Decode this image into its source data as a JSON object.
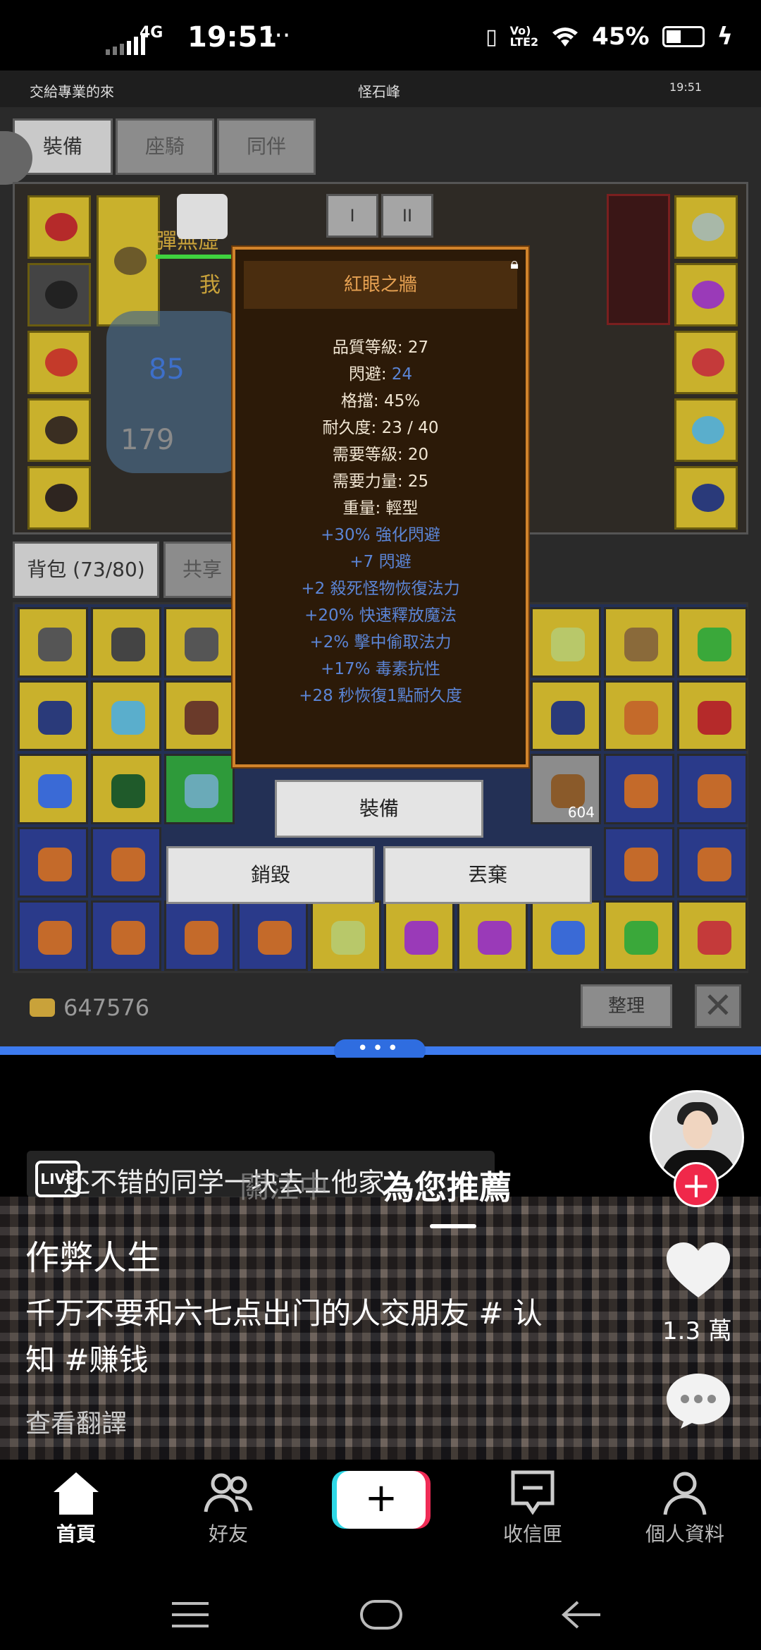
{
  "status_bar": {
    "network": "4G",
    "time": "19:51",
    "more": "···",
    "battery": "45%"
  },
  "game": {
    "header": {
      "left": "交給專業的來",
      "center": "怪石峰",
      "right_time": "19:51"
    },
    "tabs": [
      "裝備",
      "座騎",
      "同伴"
    ],
    "stage_buttons": [
      "I",
      "II"
    ],
    "bag_tab": "背包 (73/80)",
    "share_tab": "共享",
    "name_partial": "彈無虛",
    "self_tag": "我",
    "damage_numbers": [
      "85",
      "179"
    ],
    "stack_count": "604",
    "tooltip": {
      "title": "紅眼之牆",
      "lines": [
        {
          "label": "品質等級: 27"
        },
        {
          "label": "閃避: ",
          "value": "24"
        },
        {
          "label": "格擋: 45%"
        },
        {
          "label": "耐久度: 23 / 40"
        },
        {
          "label": "需要等級: 20"
        },
        {
          "label": "需要力量: 25"
        },
        {
          "label": "重量: 輕型"
        }
      ],
      "bonuses": [
        "+30% 強化閃避",
        "+7 閃避",
        "+2 殺死怪物恢復法力",
        "+20% 快速釋放魔法",
        "+2% 擊中偷取法力",
        "+17% 毒素抗性",
        "+28 秒恢復1點耐久度"
      ]
    },
    "actions": {
      "equip": "裝備",
      "destroy": "銷毀",
      "discard": "丟棄"
    },
    "gold": "647576",
    "sort_button": "整理",
    "close_button": "✕"
  },
  "tiktok": {
    "live_text": "还不错的同学一块去上他家",
    "live_label": "LIVE",
    "following_ghost": "關注中",
    "for_you": "為您推薦",
    "author": "作弊人生",
    "caption": "千万不要和六七点出门的人交朋友 # 认知 #赚钱",
    "translate": "查看翻譯",
    "like_count": "1.3 萬",
    "follow_plus": "+"
  },
  "bottom_nav": {
    "home": "首頁",
    "friends": "好友",
    "create": "+",
    "inbox": "收信匣",
    "profile": "個人資料"
  },
  "colors": {
    "tooltip_border": "#d1832b",
    "tooltip_title": "#e6a152",
    "bonus_blue": "#5b85d6",
    "split_blue": "#3d7bef",
    "tiktok_red": "#f02c56",
    "tiktok_cyan": "#2fd8e6"
  }
}
